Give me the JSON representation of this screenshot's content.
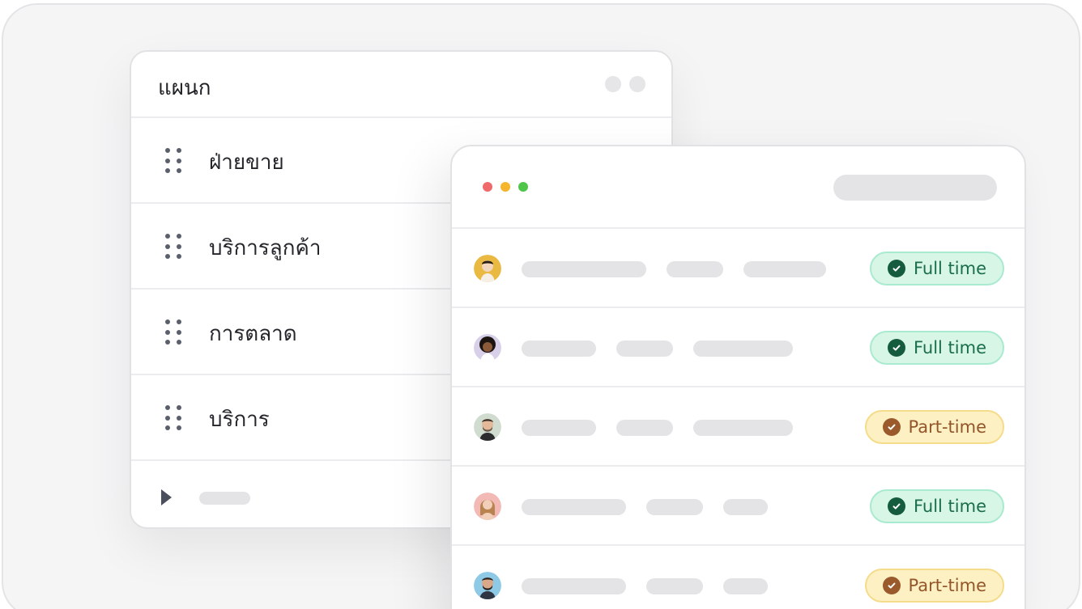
{
  "departments": {
    "title": "แผนก",
    "items": [
      {
        "label": "ฝ่ายขาย"
      },
      {
        "label": "บริการลูกค้า"
      },
      {
        "label": "การตลาด"
      },
      {
        "label": "บริการ"
      }
    ]
  },
  "employees": {
    "window_controls": [
      "#ef6b6b",
      "#f5b52e",
      "#4fc64a"
    ],
    "rows": [
      {
        "status": "Full time",
        "type": "full",
        "avatar": "avatar-1"
      },
      {
        "status": "Full time",
        "type": "full",
        "avatar": "avatar-2"
      },
      {
        "status": "Part-time",
        "type": "part",
        "avatar": "avatar-3"
      },
      {
        "status": "Full time",
        "type": "full",
        "avatar": "avatar-4"
      },
      {
        "status": "Part-time",
        "type": "part",
        "avatar": "avatar-5"
      }
    ]
  },
  "colors": {
    "full_bg": "#d7f6e6",
    "full_text": "#1b6e4a",
    "part_bg": "#fdf1c4",
    "part_text": "#94552a"
  },
  "icons": {
    "badge_full": "check-circle-icon",
    "badge_part": "check-circle-icon",
    "drag": "drag-handle-icon",
    "expand": "caret-right-icon"
  }
}
